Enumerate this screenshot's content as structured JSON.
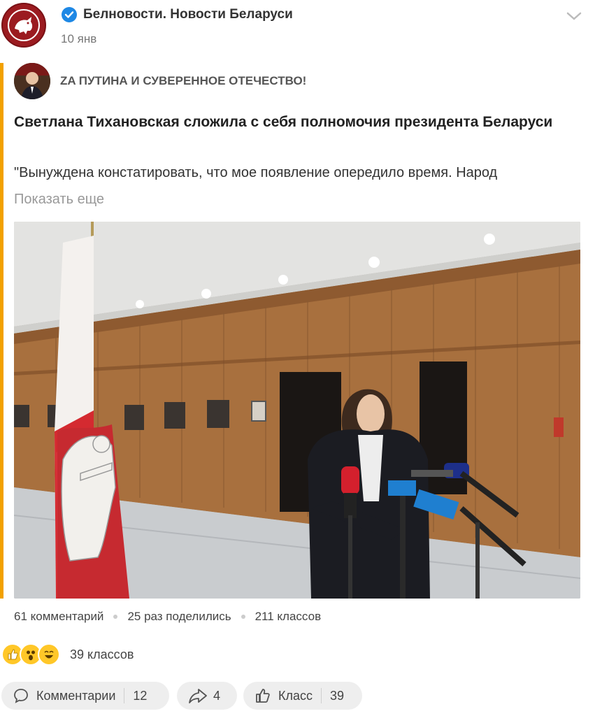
{
  "post": {
    "group_name": "Белновости. Новости Беларуси",
    "date": "10 янв",
    "author_name": "ZA ПУТИНА И СУВЕРЕННОЕ ОТЕЧЕСТВО!",
    "title": "Светлана Тихановская сложила с себя полномочия президента Беларуси",
    "excerpt": "\"Вынуждена констатировать, что мое появление опередило время. Народ",
    "show_more": "Показать еще"
  },
  "stats": {
    "comments": "61 комментарий",
    "shares": "25 раз поделились",
    "likes": "211 классов"
  },
  "reactions": {
    "count_label": "39 классов"
  },
  "actions": {
    "comments_label": "Комментарии",
    "comments_count": "12",
    "share_count": "4",
    "like_label": "Класс",
    "like_count": "39"
  },
  "colors": {
    "accent_bar": "#f2a100",
    "verified": "#1e88e5",
    "emoji": "#ffc728"
  },
  "icons": [
    "group-logo-icon",
    "verified-icon",
    "chevron-down-icon",
    "comment-icon",
    "share-icon",
    "like-icon"
  ]
}
